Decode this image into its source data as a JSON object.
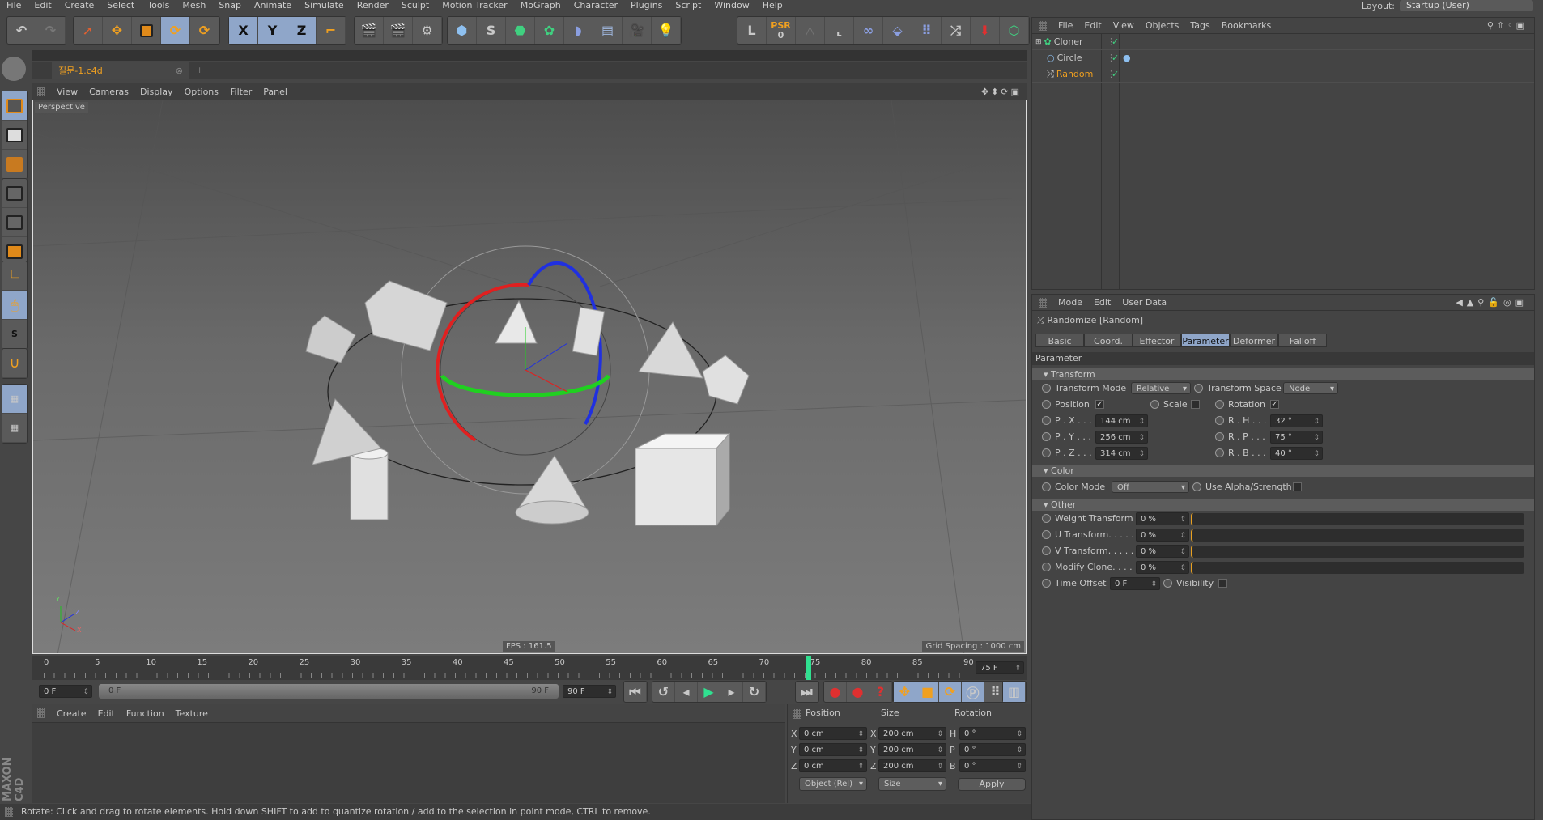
{
  "menu": [
    "File",
    "Edit",
    "Create",
    "Select",
    "Tools",
    "Mesh",
    "Snap",
    "Animate",
    "Simulate",
    "Render",
    "Sculpt",
    "Motion Tracker",
    "MoGraph",
    "Character",
    "Plugins",
    "Script",
    "Window",
    "Help"
  ],
  "layout": {
    "label": "Layout:",
    "value": "Startup (User)"
  },
  "toolbar": {
    "psr_label": "PSR",
    "psr_value": "0",
    "axis_x": "X",
    "axis_y": "Y",
    "axis_z": "Z"
  },
  "document_tab": {
    "name": "질문-1.c4d",
    "add": "+"
  },
  "viewport": {
    "menu": [
      "View",
      "Cameras",
      "Display",
      "Options",
      "Filter",
      "Panel"
    ],
    "camera": "Perspective",
    "fps": "FPS : 161.5",
    "grid_spacing": "Grid Spacing : 1000 cm",
    "axis_y": "Y",
    "axis_x": "X",
    "axis_z": "Z"
  },
  "timeline": {
    "ticks": [
      "0",
      "5",
      "10",
      "15",
      "20",
      "25",
      "30",
      "35",
      "40",
      "45",
      "50",
      "55",
      "60",
      "65",
      "70",
      "75",
      "80",
      "85",
      "90"
    ],
    "current_frame": 75,
    "max_frame": 90,
    "current_field": "75 F",
    "start_field": "0 F",
    "range_start": "0 F",
    "range_end": "90 F",
    "end_field": "90 F"
  },
  "material_manager": {
    "menu": [
      "Create",
      "Edit",
      "Function",
      "Texture"
    ]
  },
  "coordinates": {
    "headers": [
      "Position",
      "Size",
      "Rotation"
    ],
    "rows": [
      {
        "axis": "X",
        "pos": "0 cm",
        "saxis": "X",
        "size": "200 cm",
        "raxis": "H",
        "rot": "0 °"
      },
      {
        "axis": "Y",
        "pos": "0 cm",
        "saxis": "Y",
        "size": "200 cm",
        "raxis": "P",
        "rot": "0 °"
      },
      {
        "axis": "Z",
        "pos": "0 cm",
        "saxis": "Z",
        "size": "200 cm",
        "raxis": "B",
        "rot": "0 °"
      }
    ],
    "mode": "Object (Rel)",
    "size_mode": "Size",
    "apply": "Apply"
  },
  "status": "Rotate: Click and drag to rotate elements. Hold down SHIFT to add to quantize rotation / add to the selection in point mode, CTRL to remove.",
  "brand": {
    "logo_text": "MAXON CINEMA 4D"
  },
  "object_manager": {
    "menu": [
      "File",
      "Edit",
      "View",
      "Objects",
      "Tags",
      "Bookmarks"
    ],
    "objects": [
      {
        "name": "Cloner",
        "check": "✓"
      },
      {
        "name": "Circle",
        "check": "✓"
      },
      {
        "name": "Random",
        "check": "✓"
      }
    ],
    "selected_color": "#f0a020"
  },
  "attributes": {
    "menu": [
      "Mode",
      "Edit",
      "User Data"
    ],
    "title": "Randomize [Random]",
    "tabs": [
      "Basic",
      "Coord.",
      "Effector",
      "Parameter",
      "Deformer",
      "Falloff"
    ],
    "active_tab": "Parameter",
    "section": "Parameter",
    "transform": {
      "header": "Transform",
      "mode_label": "Transform Mode",
      "mode": "Relative",
      "space_label": "Transform Space",
      "space": "Node",
      "position_label": "Position",
      "position_checked": "✓",
      "scale_label": "Scale",
      "rotation_label": "Rotation",
      "rotation_checked": "✓",
      "px_label": "P . X . . .",
      "px": "144 cm",
      "py_label": "P . Y . . .",
      "py": "256 cm",
      "pz_label": "P . Z . . .",
      "pz": "314 cm",
      "rh_label": "R . H . . .",
      "rh": "32 °",
      "rp_label": "R . P . . .",
      "rp": "75 °",
      "rb_label": "R . B . . .",
      "rb": "40 °"
    },
    "color": {
      "header": "Color",
      "mode_label": "Color Mode",
      "mode": "Off",
      "alpha_label": "Use Alpha/Strength"
    },
    "other": {
      "header": "Other",
      "weight_label": "Weight Transform",
      "weight": "0 %",
      "u_label": "U Transform. . . . .",
      "u": "0 %",
      "v_label": "V Transform. . . . .",
      "v": "0 %",
      "modify_label": "Modify Clone. . . .",
      "modify": "0 %",
      "time_label": "Time Offset",
      "time": "0 F",
      "visibility_label": "Visibility"
    }
  },
  "accent": "#8fa6c9"
}
